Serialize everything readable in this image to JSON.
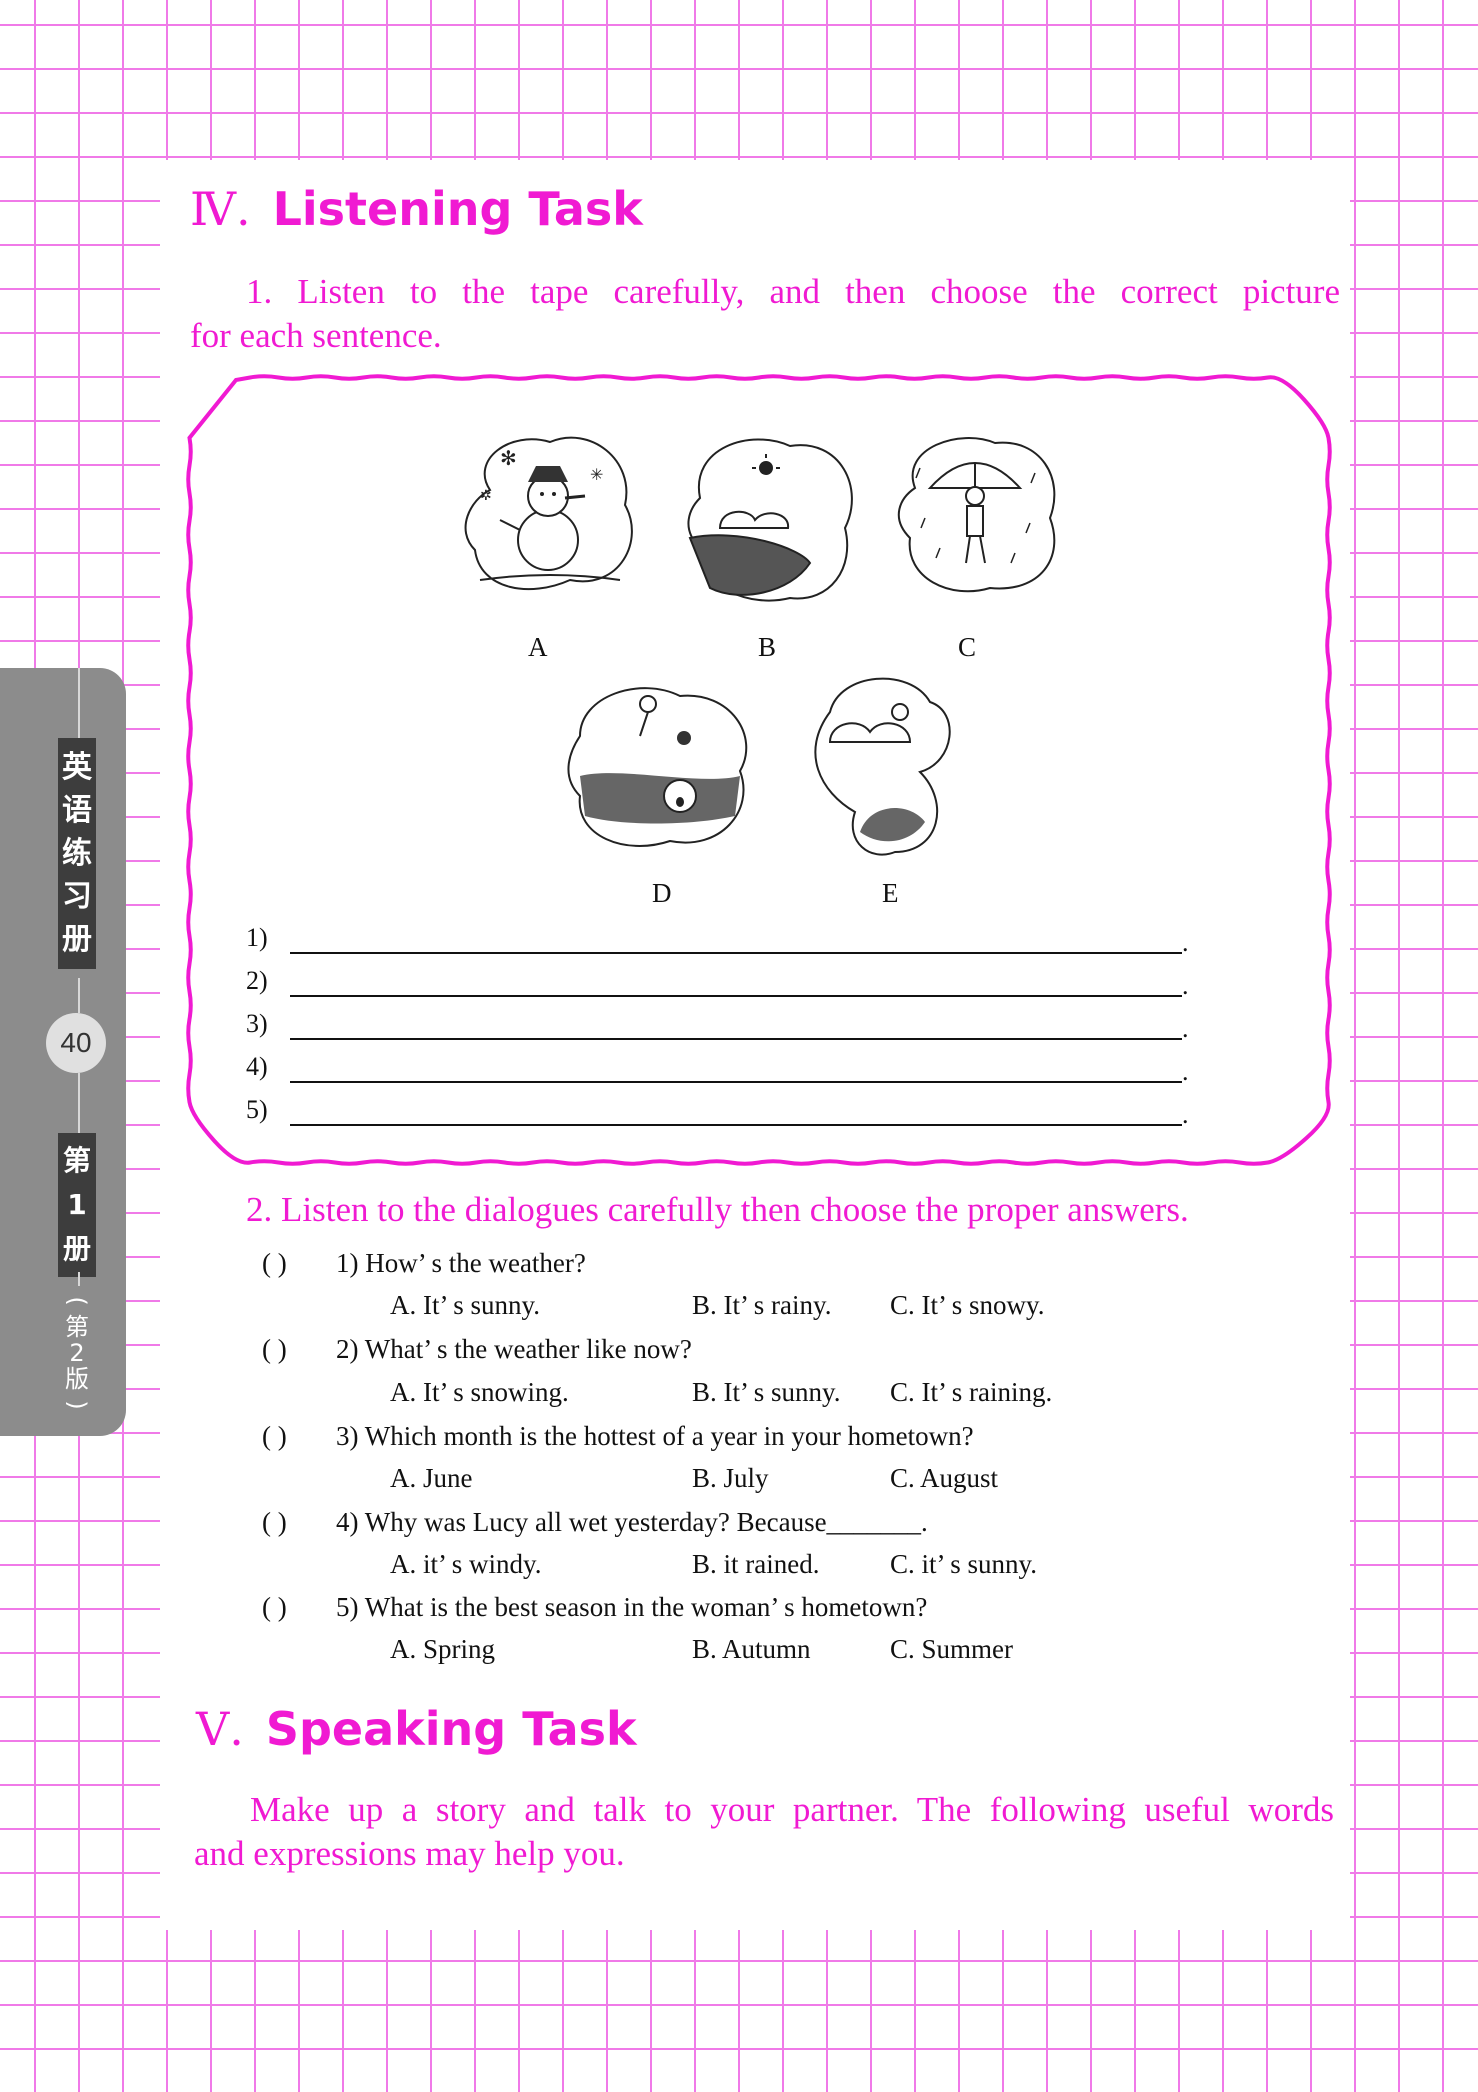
{
  "side_tab": {
    "title_chars": [
      "英",
      "语",
      "练",
      "习",
      "册"
    ],
    "page_number": "40",
    "volume_chars": [
      "第",
      "1",
      "册"
    ],
    "edition_chars": [
      "(",
      "第",
      "2",
      "版",
      ")"
    ]
  },
  "section4": {
    "numeral": "Ⅳ.",
    "title": "Listening Task",
    "task1_line1": "1. Listen to the tape carefully, and then choose the correct picture",
    "task1_line2": "for each sentence.",
    "pictures": [
      "A",
      "B",
      "C",
      "D",
      "E"
    ],
    "answer_labels": [
      "1)",
      "2)",
      "3)",
      "4)",
      "5)"
    ],
    "period": ".",
    "task2": "2. Listen to the dialogues carefully then choose the proper answers.",
    "questions": [
      {
        "bracket": "(    )",
        "stem": "1) How’ s the weather?",
        "options": [
          "A. It’ s sunny.",
          "B. It’ s rainy.",
          "C. It’ s snowy."
        ]
      },
      {
        "bracket": "(    )",
        "stem": "2) What’ s the weather like now?",
        "options": [
          "A. It’ s snowing.",
          "B. It’ s sunny.",
          "C. It’ s raining."
        ]
      },
      {
        "bracket": "(    )",
        "stem": "3) Which month is the hottest of a year in your hometown?",
        "options": [
          "A. June",
          "B. July",
          "C. August"
        ]
      },
      {
        "bracket": "(    )",
        "stem": "4) Why was Lucy all wet yesterday? Because_______.",
        "options": [
          "A. it’ s windy.",
          "B. it rained.",
          "C. it’ s sunny."
        ]
      },
      {
        "bracket": "(    )",
        "stem": "5) What is the best season in the woman’ s hometown?",
        "options": [
          "A. Spring",
          "B. Autumn",
          "C. Summer"
        ]
      }
    ]
  },
  "section5": {
    "numeral": "Ⅴ.",
    "title": "Speaking Task",
    "para_line1": "Make up a story and talk to your partner. The following useful words",
    "para_line2": "and expressions may help you."
  },
  "colors": {
    "accent": "#f01ad2",
    "grid": "#f07ae8",
    "tab": "#8c8c8c"
  }
}
